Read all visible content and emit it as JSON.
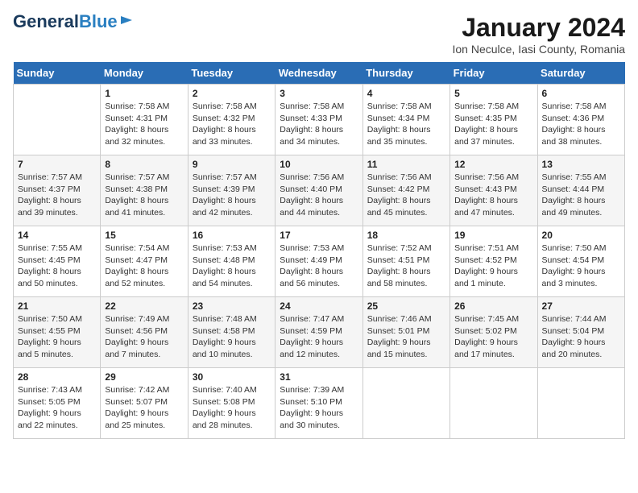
{
  "header": {
    "logo_line1": "General",
    "logo_line2": "Blue",
    "title": "January 2024",
    "subtitle": "Ion Neculce, Iasi County, Romania"
  },
  "days_of_week": [
    "Sunday",
    "Monday",
    "Tuesday",
    "Wednesday",
    "Thursday",
    "Friday",
    "Saturday"
  ],
  "weeks": [
    [
      {
        "num": "",
        "info": ""
      },
      {
        "num": "1",
        "info": "Sunrise: 7:58 AM\nSunset: 4:31 PM\nDaylight: 8 hours\nand 32 minutes."
      },
      {
        "num": "2",
        "info": "Sunrise: 7:58 AM\nSunset: 4:32 PM\nDaylight: 8 hours\nand 33 minutes."
      },
      {
        "num": "3",
        "info": "Sunrise: 7:58 AM\nSunset: 4:33 PM\nDaylight: 8 hours\nand 34 minutes."
      },
      {
        "num": "4",
        "info": "Sunrise: 7:58 AM\nSunset: 4:34 PM\nDaylight: 8 hours\nand 35 minutes."
      },
      {
        "num": "5",
        "info": "Sunrise: 7:58 AM\nSunset: 4:35 PM\nDaylight: 8 hours\nand 37 minutes."
      },
      {
        "num": "6",
        "info": "Sunrise: 7:58 AM\nSunset: 4:36 PM\nDaylight: 8 hours\nand 38 minutes."
      }
    ],
    [
      {
        "num": "7",
        "info": "Sunrise: 7:57 AM\nSunset: 4:37 PM\nDaylight: 8 hours\nand 39 minutes."
      },
      {
        "num": "8",
        "info": "Sunrise: 7:57 AM\nSunset: 4:38 PM\nDaylight: 8 hours\nand 41 minutes."
      },
      {
        "num": "9",
        "info": "Sunrise: 7:57 AM\nSunset: 4:39 PM\nDaylight: 8 hours\nand 42 minutes."
      },
      {
        "num": "10",
        "info": "Sunrise: 7:56 AM\nSunset: 4:40 PM\nDaylight: 8 hours\nand 44 minutes."
      },
      {
        "num": "11",
        "info": "Sunrise: 7:56 AM\nSunset: 4:42 PM\nDaylight: 8 hours\nand 45 minutes."
      },
      {
        "num": "12",
        "info": "Sunrise: 7:56 AM\nSunset: 4:43 PM\nDaylight: 8 hours\nand 47 minutes."
      },
      {
        "num": "13",
        "info": "Sunrise: 7:55 AM\nSunset: 4:44 PM\nDaylight: 8 hours\nand 49 minutes."
      }
    ],
    [
      {
        "num": "14",
        "info": "Sunrise: 7:55 AM\nSunset: 4:45 PM\nDaylight: 8 hours\nand 50 minutes."
      },
      {
        "num": "15",
        "info": "Sunrise: 7:54 AM\nSunset: 4:47 PM\nDaylight: 8 hours\nand 52 minutes."
      },
      {
        "num": "16",
        "info": "Sunrise: 7:53 AM\nSunset: 4:48 PM\nDaylight: 8 hours\nand 54 minutes."
      },
      {
        "num": "17",
        "info": "Sunrise: 7:53 AM\nSunset: 4:49 PM\nDaylight: 8 hours\nand 56 minutes."
      },
      {
        "num": "18",
        "info": "Sunrise: 7:52 AM\nSunset: 4:51 PM\nDaylight: 8 hours\nand 58 minutes."
      },
      {
        "num": "19",
        "info": "Sunrise: 7:51 AM\nSunset: 4:52 PM\nDaylight: 9 hours\nand 1 minute."
      },
      {
        "num": "20",
        "info": "Sunrise: 7:50 AM\nSunset: 4:54 PM\nDaylight: 9 hours\nand 3 minutes."
      }
    ],
    [
      {
        "num": "21",
        "info": "Sunrise: 7:50 AM\nSunset: 4:55 PM\nDaylight: 9 hours\nand 5 minutes."
      },
      {
        "num": "22",
        "info": "Sunrise: 7:49 AM\nSunset: 4:56 PM\nDaylight: 9 hours\nand 7 minutes."
      },
      {
        "num": "23",
        "info": "Sunrise: 7:48 AM\nSunset: 4:58 PM\nDaylight: 9 hours\nand 10 minutes."
      },
      {
        "num": "24",
        "info": "Sunrise: 7:47 AM\nSunset: 4:59 PM\nDaylight: 9 hours\nand 12 minutes."
      },
      {
        "num": "25",
        "info": "Sunrise: 7:46 AM\nSunset: 5:01 PM\nDaylight: 9 hours\nand 15 minutes."
      },
      {
        "num": "26",
        "info": "Sunrise: 7:45 AM\nSunset: 5:02 PM\nDaylight: 9 hours\nand 17 minutes."
      },
      {
        "num": "27",
        "info": "Sunrise: 7:44 AM\nSunset: 5:04 PM\nDaylight: 9 hours\nand 20 minutes."
      }
    ],
    [
      {
        "num": "28",
        "info": "Sunrise: 7:43 AM\nSunset: 5:05 PM\nDaylight: 9 hours\nand 22 minutes."
      },
      {
        "num": "29",
        "info": "Sunrise: 7:42 AM\nSunset: 5:07 PM\nDaylight: 9 hours\nand 25 minutes."
      },
      {
        "num": "30",
        "info": "Sunrise: 7:40 AM\nSunset: 5:08 PM\nDaylight: 9 hours\nand 28 minutes."
      },
      {
        "num": "31",
        "info": "Sunrise: 7:39 AM\nSunset: 5:10 PM\nDaylight: 9 hours\nand 30 minutes."
      },
      {
        "num": "",
        "info": ""
      },
      {
        "num": "",
        "info": ""
      },
      {
        "num": "",
        "info": ""
      }
    ]
  ]
}
